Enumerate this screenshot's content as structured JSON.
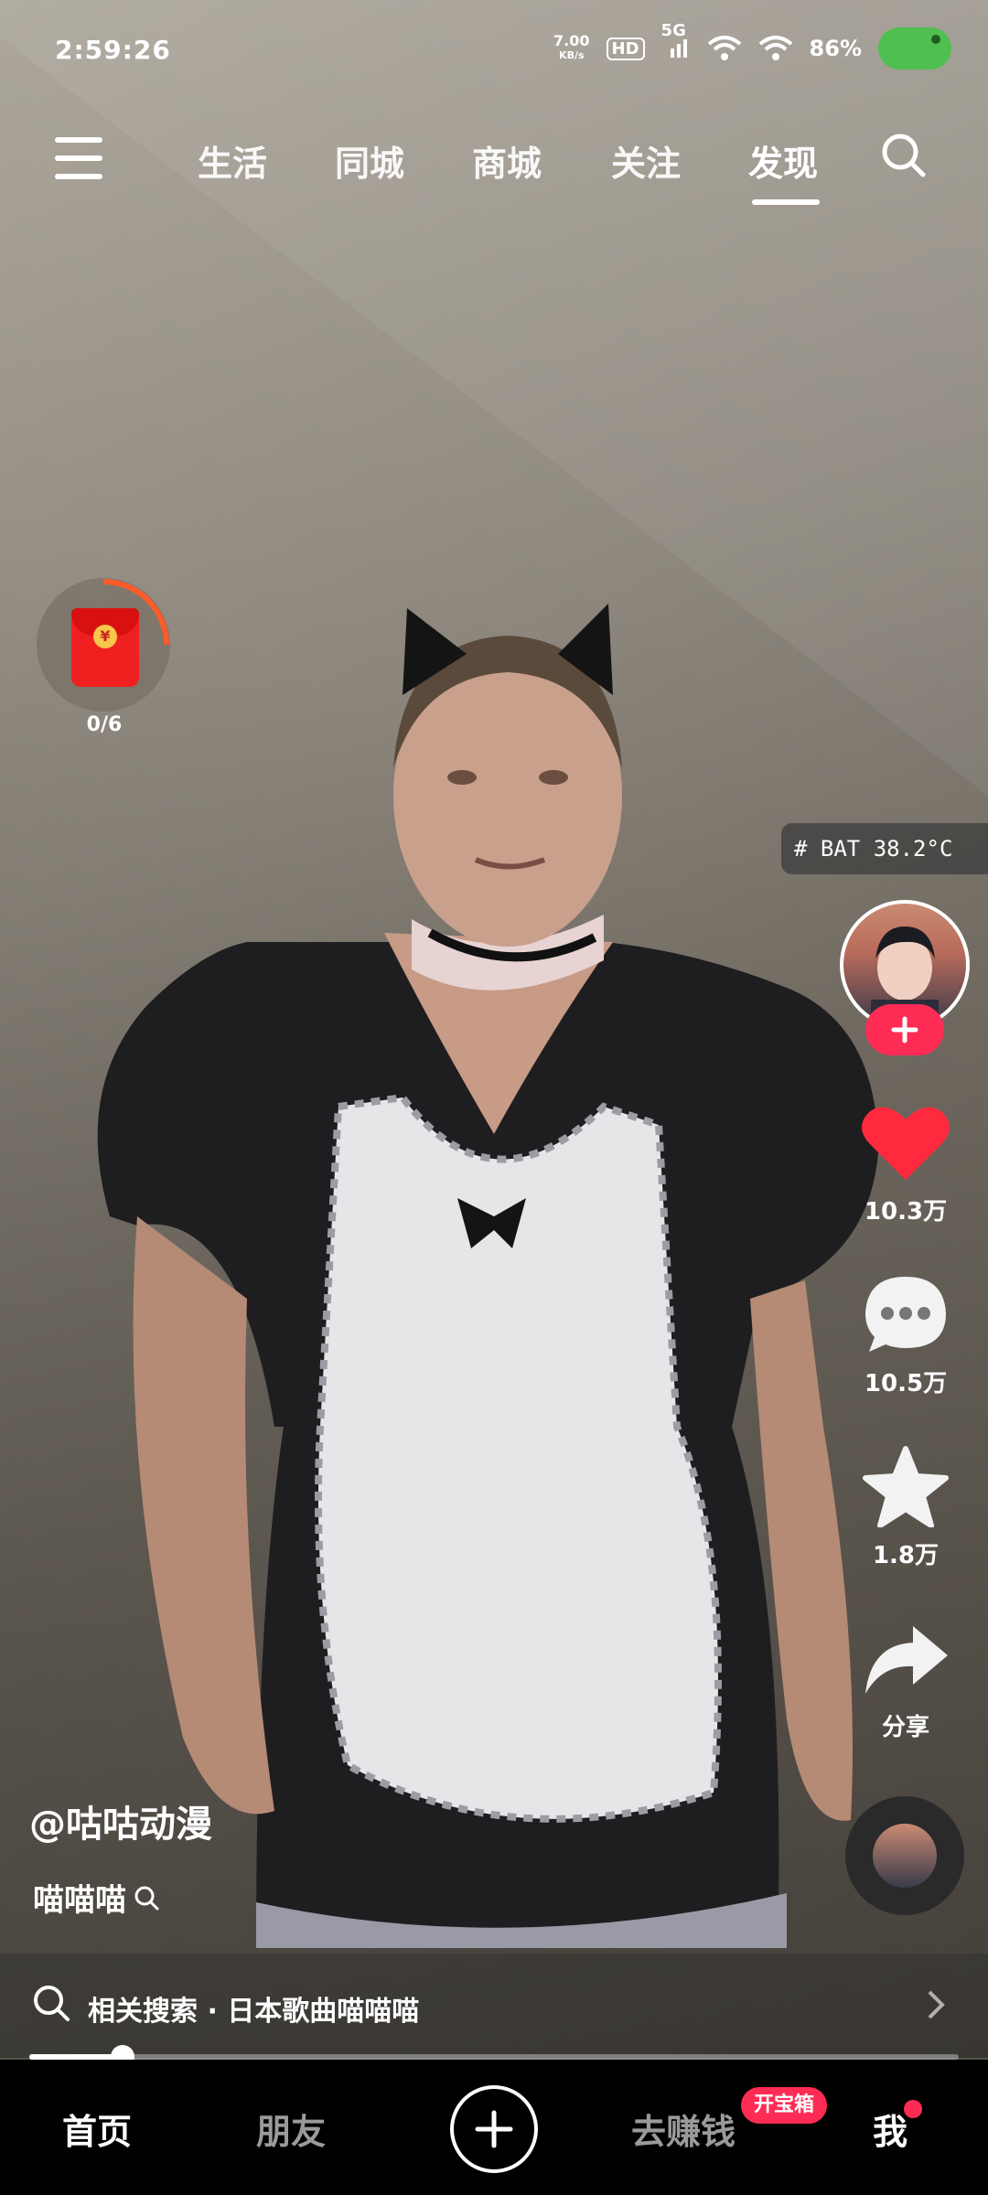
{
  "status_bar": {
    "time": "2:59:26",
    "net_speed": "7.00",
    "net_speed_unit": "KB/s",
    "hd": "HD",
    "signal_label": "5G",
    "battery": "86%"
  },
  "top_nav": {
    "tabs": [
      "生活",
      "同城",
      "商城",
      "关注",
      "发现"
    ],
    "active_tab": "发现"
  },
  "red_envelope": {
    "count": "0/6"
  },
  "overlay_chip": {
    "text": "# BAT 38.2°C"
  },
  "actions": {
    "likes": "10.3万",
    "comments": "10.5万",
    "favorites": "1.8万",
    "share": "分享"
  },
  "video": {
    "author": "@咕咕动漫",
    "description": "喵喵喵",
    "progress": 0.1
  },
  "related_search": {
    "text": "相关搜索 · 日本歌曲喵喵喵"
  },
  "bottom_nav": {
    "home": "首页",
    "friends": "朋友",
    "earn": "去赚钱",
    "earn_badge": "开宝箱",
    "me": "我"
  },
  "colors": {
    "accent": "#fe2c55",
    "like": "#ff2a3d"
  }
}
